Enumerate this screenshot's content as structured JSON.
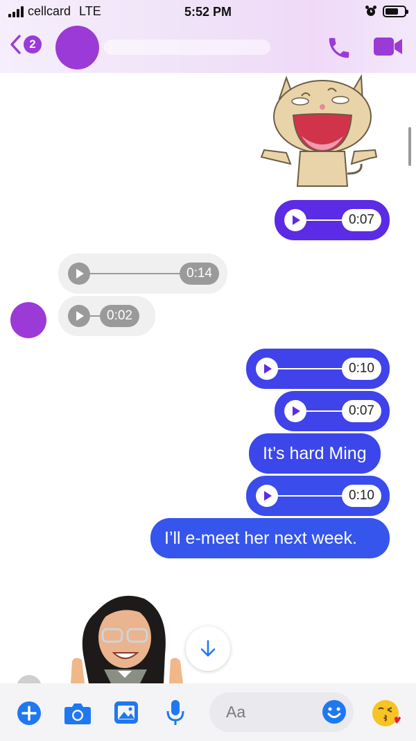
{
  "status_bar": {
    "carrier": "cellcard",
    "network": "LTE",
    "time": "5:52 PM",
    "battery_level": 0.7
  },
  "header": {
    "back_badge": "2",
    "contact_name": "",
    "icons": [
      "back-chevron-icon",
      "phone-icon",
      "video-camera-icon"
    ],
    "accent_color": "#9b3ad6"
  },
  "messages": [
    {
      "type": "sticker",
      "direction": "outgoing",
      "sticker": "laughing-cat-sticker"
    },
    {
      "type": "voice",
      "direction": "outgoing",
      "duration": "0:07"
    },
    {
      "type": "voice",
      "direction": "incoming",
      "duration": "0:14"
    },
    {
      "type": "voice",
      "direction": "incoming",
      "duration": "0:02"
    },
    {
      "type": "voice",
      "direction": "outgoing",
      "duration": "0:10"
    },
    {
      "type": "voice",
      "direction": "outgoing",
      "duration": "0:07"
    },
    {
      "type": "text",
      "direction": "outgoing",
      "text": "It’s hard Ming"
    },
    {
      "type": "voice",
      "direction": "outgoing",
      "duration": "0:10"
    },
    {
      "type": "text",
      "direction": "outgoing",
      "text": "I’ll e-meet her next week."
    }
  ],
  "composer": {
    "placeholder": "Aa",
    "icons": [
      "plus-icon",
      "camera-icon",
      "gallery-icon",
      "microphone-icon",
      "smiley-icon",
      "kiss-emoji-icon"
    ]
  },
  "colors": {
    "outgoing_purple": "#5b2be6",
    "outgoing_blue": "#3f43e9",
    "incoming_gray": "#f0f0f0",
    "icon_blue": "#1f78f0"
  }
}
